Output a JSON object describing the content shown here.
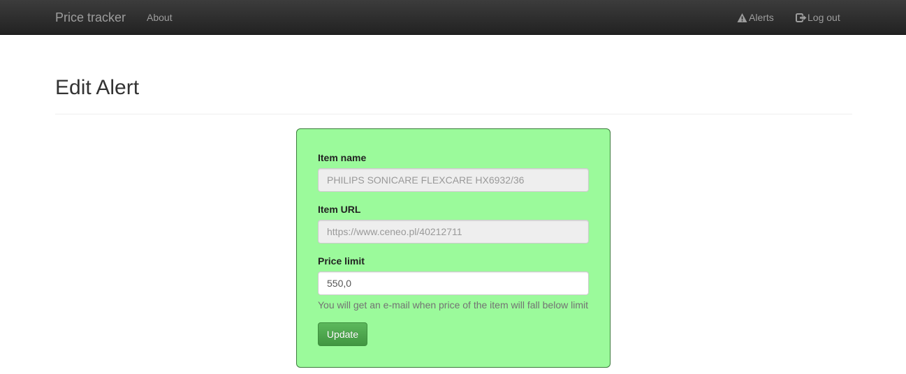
{
  "navbar": {
    "brand": "Price tracker",
    "about": "About",
    "alerts": "Alerts",
    "alerts_icon": "warning-icon",
    "logout": "Log out",
    "logout_icon": "logout-icon"
  },
  "page": {
    "title": "Edit Alert"
  },
  "form": {
    "item_name_label": "Item name",
    "item_name_value": "PHILIPS SONICARE FLEXCARE HX6932/36",
    "item_url_label": "Item URL",
    "item_url_value": "https://www.ceneo.pl/40212711",
    "price_limit_label": "Price limit",
    "price_limit_value": "550,0",
    "help_text": "You will get an e-mail when price of the item will fall below limit",
    "submit_label": "Update"
  },
  "colors": {
    "navbar_bg": "#222222",
    "nav_text": "#9d9d9d",
    "panel_bg": "#9bfa9b",
    "panel_border": "#3c7b3c",
    "button_bg": "#5cb85c",
    "readonly_bg": "#eeeeee"
  }
}
